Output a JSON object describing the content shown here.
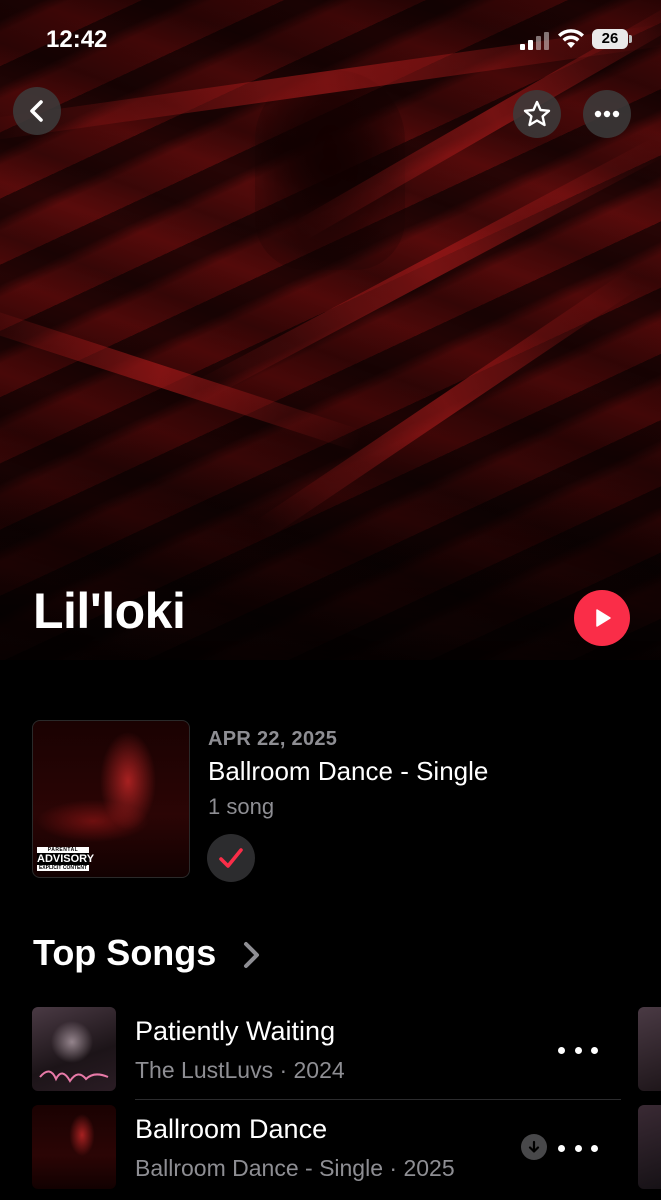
{
  "status_bar": {
    "time": "12:42",
    "battery": "26"
  },
  "artist": {
    "name": "Lil'loki"
  },
  "latest_release": {
    "date": "APR 22, 2025",
    "title": "Ballroom Dance - Single",
    "count": "1 song",
    "advisory": {
      "line1": "PARENTAL",
      "line2": "ADVISORY",
      "line3": "EXPLICIT CONTENT"
    }
  },
  "top_songs": {
    "heading": "Top Songs",
    "items": [
      {
        "title": "Patiently Waiting",
        "subtitle": "The LustLuvs · 2024"
      },
      {
        "title": "Ballroom Dance",
        "subtitle": "Ballroom Dance - Single · 2025"
      }
    ]
  },
  "icons": {
    "back": "chevron-left-icon",
    "favorite": "star-icon",
    "more": "ellipsis-icon",
    "play": "play-icon",
    "added": "checkmark-icon",
    "download": "download-arrow-icon"
  },
  "colors": {
    "accent": "#fa2d48",
    "secondary_text": "#8e8e93",
    "background": "#000000"
  }
}
